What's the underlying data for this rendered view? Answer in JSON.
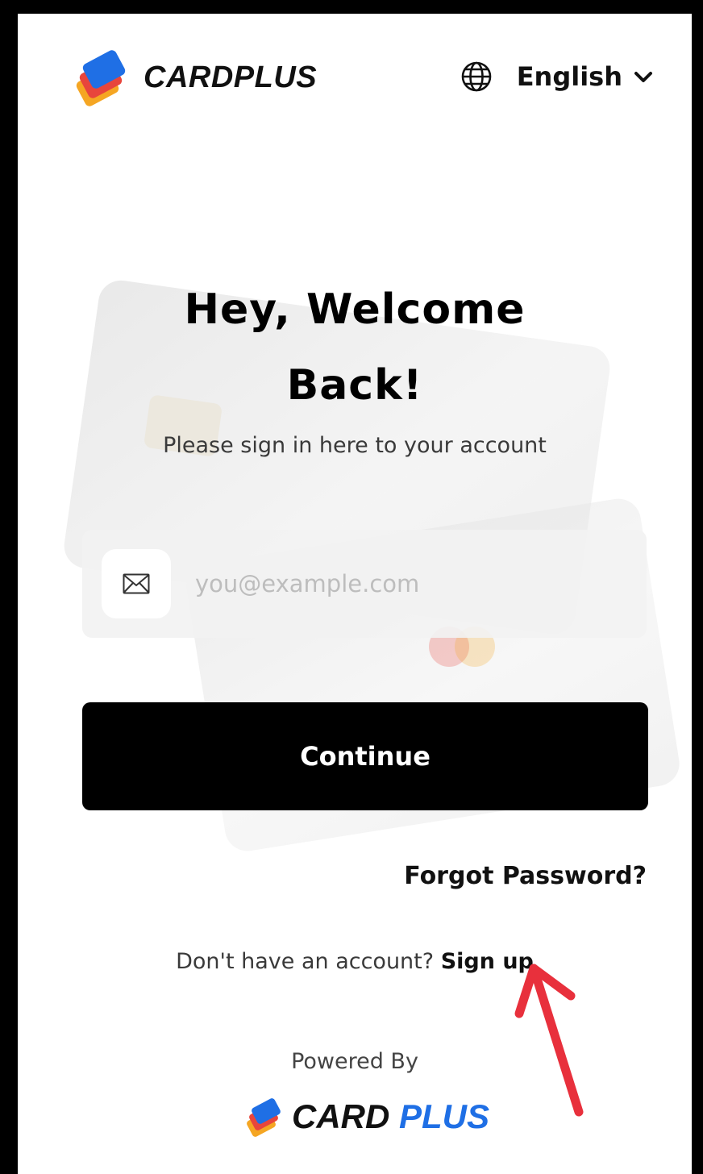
{
  "header": {
    "brand_name": "CARDPLUS",
    "language": "English"
  },
  "welcome": {
    "title_line1": "Hey, Welcome",
    "title_line2": "Back!",
    "subtitle": "Please sign in here to your account"
  },
  "email": {
    "placeholder": "you@example.com",
    "value": ""
  },
  "actions": {
    "continue_label": "Continue",
    "forgot_label": "Forgot Password?"
  },
  "signup": {
    "prompt": "Don't have an account?",
    "link_label": "Sign up"
  },
  "footer": {
    "powered_by": "Powered By",
    "brand_part1": "CARD",
    "brand_part2": "PLUS"
  },
  "colors": {
    "brand_blue": "#1f6fe5",
    "logo_orange": "#f5a623",
    "logo_red": "#e8453c",
    "annotation_arrow": "#e8303c"
  }
}
